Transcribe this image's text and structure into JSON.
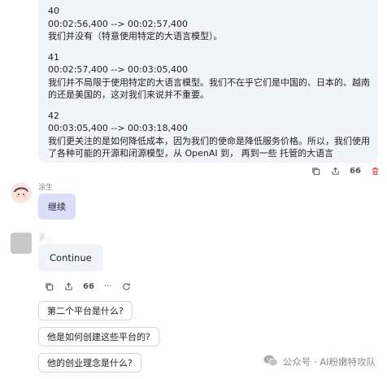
{
  "transcript": [
    {
      "index": "40",
      "time": "00:02:56,400 --> 00:02:57,400",
      "text": "我们并没有（特意使用特定的大语言模型）。"
    },
    {
      "index": "41",
      "time": "00:02:57,400 --> 00:03:05,400",
      "text": "我们并不局限于使用特定的大语言模型。我们不在乎它们是中国的、日本的、越南\n的还是美国的，这对我们来说并不重要。"
    },
    {
      "index": "42",
      "time": "00:03:05,400 --> 00:03:18,400",
      "text": "我们更关注的是如何降低成本，因为我们的使命是降低服务价格。所以，我们使用\n了各种可能的开源和闭源模型，从 OpenAI 到， 再到一些 托管的大语言"
    }
  ],
  "top_actions": {
    "quote_count": "66"
  },
  "user": {
    "name": "涂生",
    "message": "继续"
  },
  "bot": {
    "name": "子…",
    "message": "Continue",
    "quote_count": "66",
    "more": "···"
  },
  "suggestions": [
    "第二个平台是什么?",
    "他是如何创建这些平台的?",
    "他的创业理念是什么?"
  ],
  "watermark": {
    "text": "公众号 · AI粉嫩特攻队"
  },
  "colors": {
    "user_bubble": "#dcdcfb",
    "bot_bubble": "#f3f4f8",
    "delete_icon": "#e0474c"
  }
}
